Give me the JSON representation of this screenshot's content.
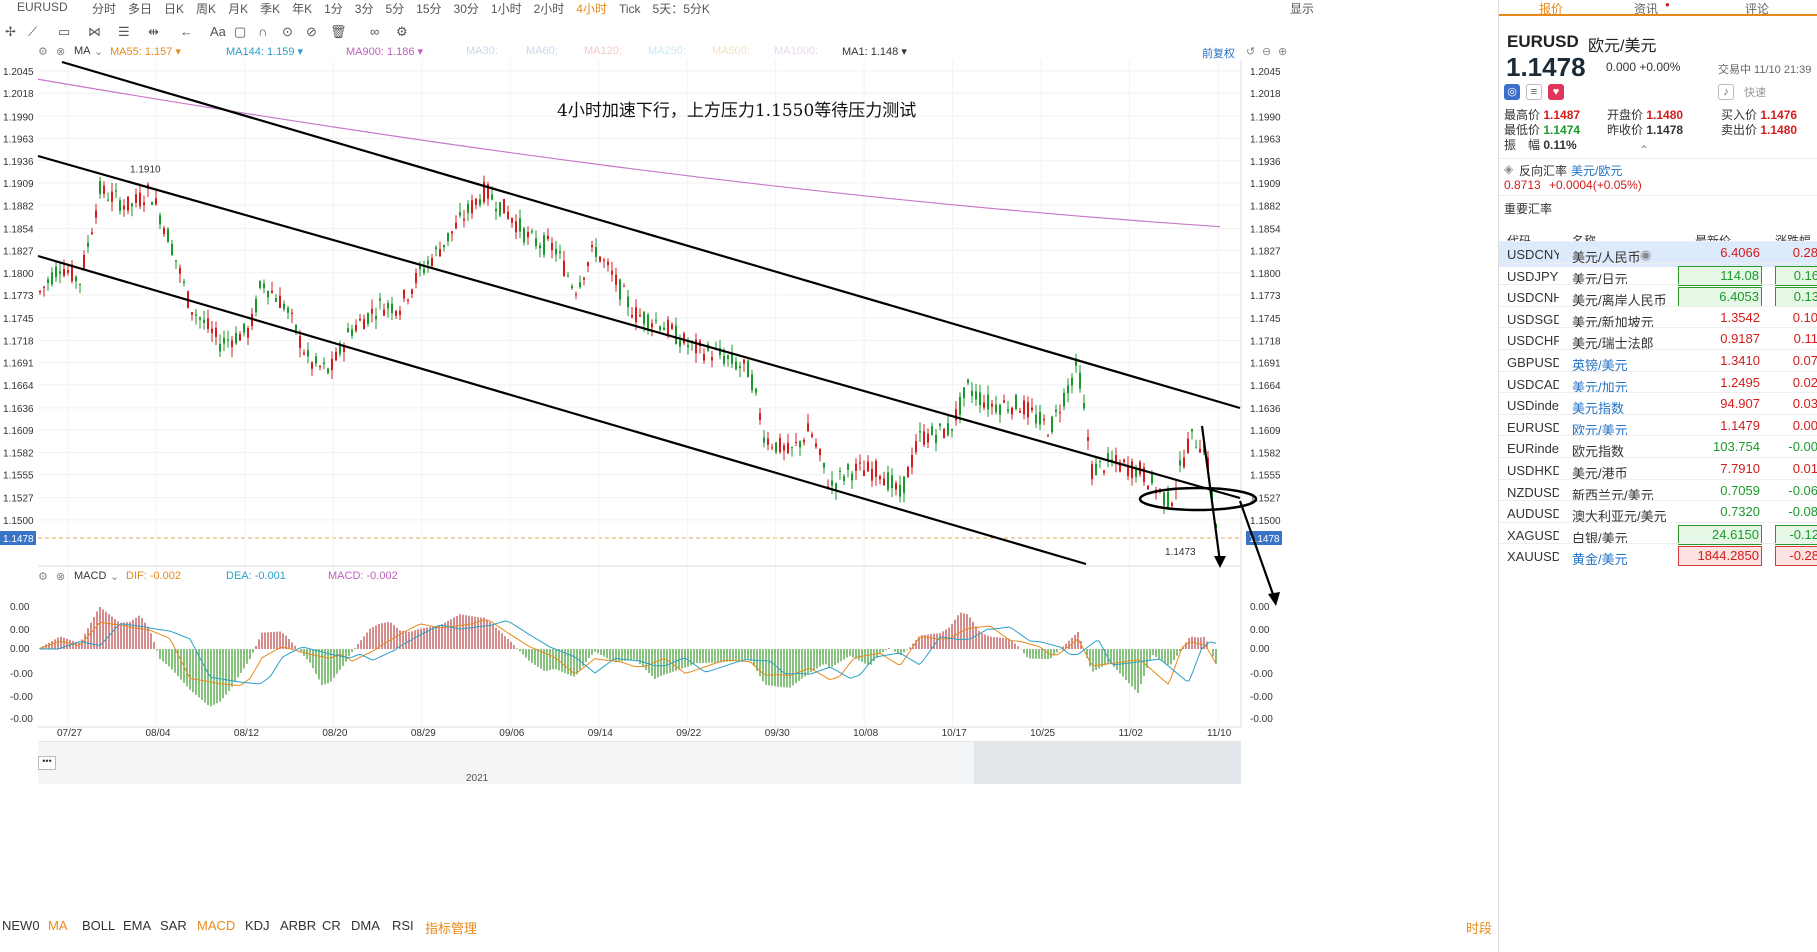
{
  "topbar": {
    "symbol": "EURUSD",
    "timeframes": [
      "分时",
      "多日",
      "日K",
      "周K",
      "月K",
      "季K",
      "年K",
      "1分",
      "3分",
      "5分",
      "15分",
      "30分",
      "1小时",
      "2小时",
      "4小时",
      "Tick",
      "5天：5分K"
    ],
    "active_timeframe": "4小时",
    "display_label": "显示"
  },
  "indicator_bar": {
    "label": "MA",
    "items": [
      {
        "text": "MA55: 1.157",
        "color": "#e8891a"
      },
      {
        "text": "MA144: 1.159",
        "color": "#2aa0c8"
      },
      {
        "text": "MA900: 1.186",
        "color": "#c060c0"
      },
      {
        "text": "MA30:",
        "color": "#c8d8f0"
      },
      {
        "text": "MA60:",
        "color": "#c8d8f0"
      },
      {
        "text": "MA120:",
        "color": "#f5c8c8"
      },
      {
        "text": "MA250:",
        "color": "#c8e8f5"
      },
      {
        "text": "MA500:",
        "color": "#f5e0c0"
      },
      {
        "text": "MA1000:",
        "color": "#e8d8f0"
      },
      {
        "text": "MA1: 1.148",
        "color": "#333333"
      }
    ],
    "adjust_label": "前复权"
  },
  "price_axis": {
    "ticks": [
      "1.2045",
      "1.2018",
      "1.1990",
      "1.1963",
      "1.1936",
      "1.1909",
      "1.1882",
      "1.1854",
      "1.1827",
      "1.1800",
      "1.1773",
      "1.1745",
      "1.1718",
      "1.1691",
      "1.1664",
      "1.1636",
      "1.1609",
      "1.1582",
      "1.1555",
      "1.1527",
      "1.1500",
      "1.1478"
    ],
    "current": "1.1478",
    "high_label": "1.1910",
    "low_label": "1.1473"
  },
  "annotation": "4小时加速下行，上方压力1.1550等待压力测试",
  "macd_bar": {
    "label": "MACD",
    "dif": "DIF: -0.002",
    "dea": "DEA: -0.001",
    "macd": "MACD: -0.002"
  },
  "macd_axis": [
    "0.00",
    "0.00",
    "0.00",
    "-0.00",
    "-0.00",
    "-0.00"
  ],
  "date_axis": [
    "07/27",
    "08/04",
    "08/12",
    "08/20",
    "08/29",
    "09/06",
    "09/14",
    "09/22",
    "09/30",
    "10/08",
    "10/17",
    "10/25",
    "11/02",
    "11/10"
  ],
  "navigator": {
    "year": "2021"
  },
  "indicator_tabs": [
    "NEW0",
    "MA",
    "BOLL",
    "EMA",
    "SAR",
    "MACD",
    "KDJ",
    "ARBR",
    "CR",
    "DMA",
    "RSI"
  ],
  "indicator_tabs_active": [
    "MA",
    "MACD"
  ],
  "indicator_manage": "指标管理",
  "time_label": "时段",
  "right": {
    "tabs": [
      "报价",
      "资讯",
      "评论"
    ],
    "symbol": "EURUSD",
    "name": "欧元/美元",
    "price": "1.1478",
    "change": "0.000 +0.00%",
    "time": "交易中 11/10 21:39",
    "quick_label": "快速",
    "stats": {
      "high_label": "最高价",
      "high": "1.1487",
      "low_label": "最低价",
      "low": "1.1474",
      "amp_label": "振　幅",
      "amp": "0.11%",
      "open_label": "开盘价",
      "open": "1.1480",
      "prev_label": "昨收价",
      "prev": "1.1478",
      "bid_label": "买入价",
      "bid": "1.1476",
      "ask_label": "卖出价",
      "ask": "1.1480"
    },
    "reverse": {
      "label": "反向汇率",
      "pair": "美元/欧元",
      "value": "0.8713",
      "change": "+0.0004(+0.05%)"
    },
    "rates_title": "重要汇率",
    "rates_headers": [
      "代码",
      "名称",
      "最新价",
      "涨跌幅"
    ],
    "rates": [
      {
        "code": "USDCNY",
        "name": "美元/人民币",
        "price": "6.4066",
        "pct": "0.28",
        "dir": "r",
        "box": ""
      },
      {
        "code": "USDJPY",
        "name": "美元/日元",
        "price": "114.08",
        "pct": "0.16",
        "dir": "g",
        "box": "g"
      },
      {
        "code": "USDCNH",
        "name": "美元/离岸人民币",
        "price": "6.4053",
        "pct": "0.13",
        "dir": "g",
        "box": "g"
      },
      {
        "code": "USDSGD",
        "name": "美元/新加坡元",
        "price": "1.3542",
        "pct": "0.10",
        "dir": "r",
        "box": ""
      },
      {
        "code": "USDCHF",
        "name": "美元/瑞士法郎",
        "price": "0.9187",
        "pct": "0.11",
        "dir": "r",
        "box": ""
      },
      {
        "code": "GBPUSD",
        "name": "英镑/美元",
        "price": "1.3410",
        "pct": "0.07",
        "dir": "r",
        "box": ""
      },
      {
        "code": "USDCAD",
        "name": "美元/加元",
        "price": "1.2495",
        "pct": "0.02",
        "dir": "r",
        "box": ""
      },
      {
        "code": "USDindex",
        "name": "美元指数",
        "price": "94.907",
        "pct": "0.03",
        "dir": "r",
        "box": ""
      },
      {
        "code": "EURUSD",
        "name": "欧元/美元",
        "price": "1.1479",
        "pct": "0.00",
        "dir": "r",
        "box": ""
      },
      {
        "code": "EURindex",
        "name": "欧元指数",
        "price": "103.754",
        "pct": "-0.00",
        "dir": "g",
        "box": ""
      },
      {
        "code": "USDHKD",
        "name": "美元/港币",
        "price": "7.7910",
        "pct": "0.01",
        "dir": "r",
        "box": ""
      },
      {
        "code": "NZDUSD",
        "name": "新西兰元/美元",
        "price": "0.7059",
        "pct": "-0.06",
        "dir": "g",
        "box": ""
      },
      {
        "code": "AUDUSD",
        "name": "澳大利亚元/美元",
        "price": "0.7320",
        "pct": "-0.08",
        "dir": "g",
        "box": ""
      },
      {
        "code": "XAGUSD",
        "name": "白银/美元",
        "price": "24.6150",
        "pct": "-0.12",
        "dir": "g",
        "box": "g"
      },
      {
        "code": "XAUUSD",
        "name": "黄金/美元",
        "price": "1844.2850",
        "pct": "-0.28",
        "dir": "r",
        "box": "r"
      }
    ]
  },
  "colors": {
    "up": "#d41c1c",
    "down": "#1a9a2a",
    "accent": "#e8891a",
    "ma55": "#e8a050",
    "ma144": "#40a8c8",
    "ma900": "#c878c8"
  }
}
